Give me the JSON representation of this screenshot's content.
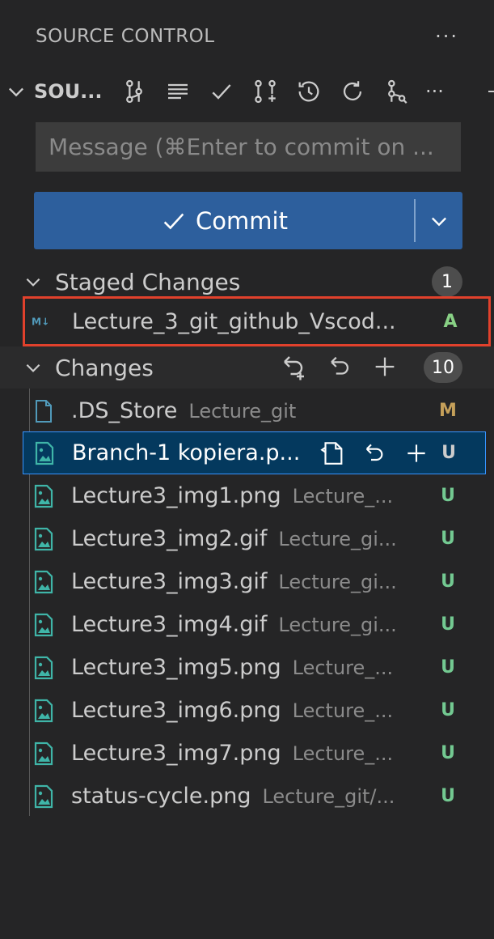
{
  "panel": {
    "title": "SOURCE CONTROL",
    "more_label": "···"
  },
  "repo": {
    "title": "SOU...",
    "more_label": "···",
    "actions": [
      "graph-icon",
      "list-icon",
      "check-icon",
      "pull-request-icon",
      "history-icon",
      "refresh-icon",
      "branch-icon"
    ]
  },
  "message": {
    "placeholder": "Message (⌘Enter to commit on ..."
  },
  "commit": {
    "label": "Commit",
    "check": "✓"
  },
  "staged": {
    "label": "Staged Changes",
    "count": "1",
    "items": [
      {
        "name": "Lecture_3_git_github_Vscod...",
        "path": "",
        "status": "A",
        "status_color": "#89d185",
        "icon": "markdown-icon"
      }
    ]
  },
  "changes": {
    "label": "Changes",
    "count": "10",
    "items": [
      {
        "name": ".DS_Store",
        "path": "Lecture_git",
        "status": "M",
        "status_color": "#c5a05a",
        "icon": "file-icon"
      },
      {
        "name": "Branch-1 kopiera.p...",
        "path": "",
        "status": "U",
        "status_color": "#cccccc",
        "icon": "image-icon",
        "selected": true
      },
      {
        "name": "Lecture3_img1.png",
        "path": "Lecture_...",
        "status": "U",
        "status_color": "#73c991",
        "icon": "image-icon"
      },
      {
        "name": "Lecture3_img2.gif",
        "path": "Lecture_gi...",
        "status": "U",
        "status_color": "#73c991",
        "icon": "image-icon"
      },
      {
        "name": "Lecture3_img3.gif",
        "path": "Lecture_gi...",
        "status": "U",
        "status_color": "#73c991",
        "icon": "image-icon"
      },
      {
        "name": "Lecture3_img4.gif",
        "path": "Lecture_gi...",
        "status": "U",
        "status_color": "#73c991",
        "icon": "image-icon"
      },
      {
        "name": "Lecture3_img5.png",
        "path": "Lecture_...",
        "status": "U",
        "status_color": "#73c991",
        "icon": "image-icon"
      },
      {
        "name": "Lecture3_img6.png",
        "path": "Lecture_...",
        "status": "U",
        "status_color": "#73c991",
        "icon": "image-icon"
      },
      {
        "name": "Lecture3_img7.png",
        "path": "Lecture_...",
        "status": "U",
        "status_color": "#73c991",
        "icon": "image-icon"
      },
      {
        "name": "status-cycle.png",
        "path": "Lecture_git/...",
        "status": "U",
        "status_color": "#73c991",
        "icon": "image-icon"
      }
    ]
  },
  "colors": {
    "accent": "#2d5f9d",
    "highlight": "#e1412c",
    "image_icon": "#3fb5a8",
    "markdown_icon": "#519aba"
  }
}
